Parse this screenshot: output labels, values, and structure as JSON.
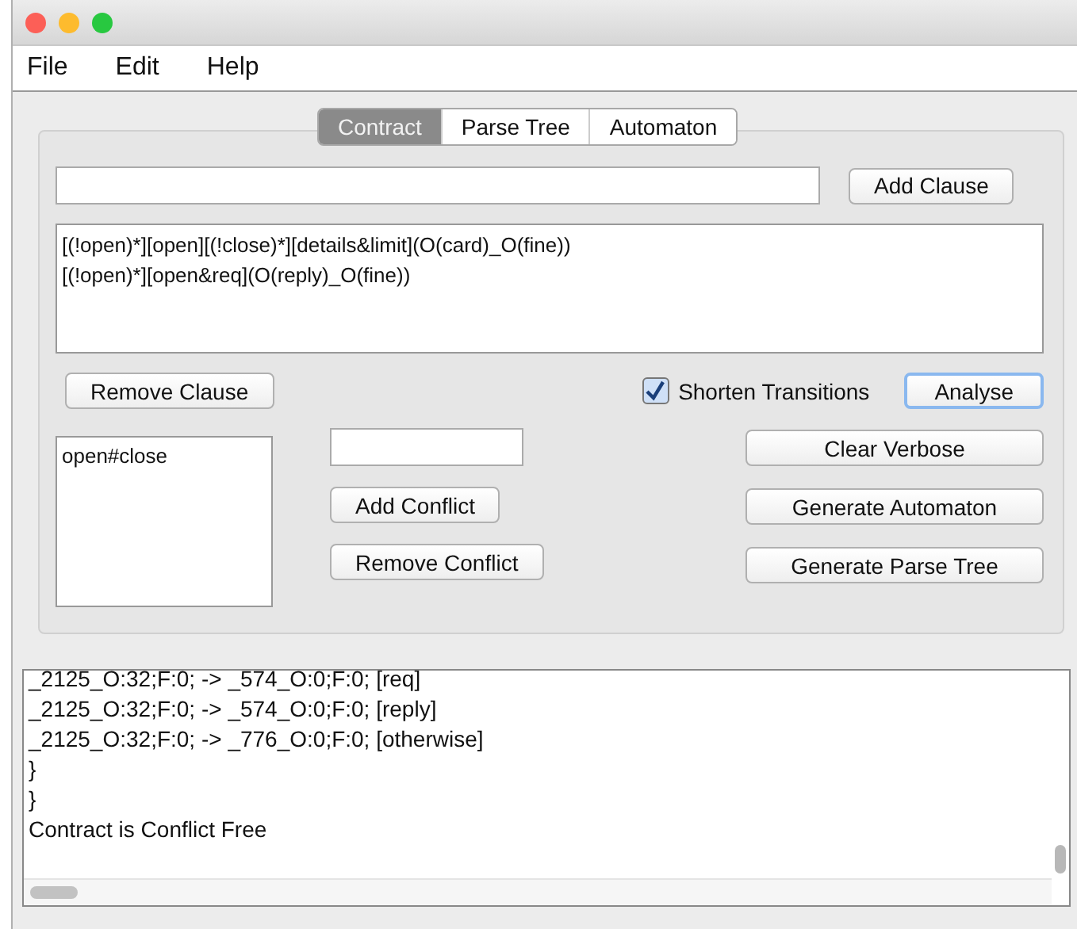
{
  "menu": [
    "File",
    "Edit",
    "Help"
  ],
  "tabs": [
    {
      "label": "Contract",
      "selected": true
    },
    {
      "label": "Parse Tree",
      "selected": false
    },
    {
      "label": "Automaton",
      "selected": false
    }
  ],
  "add_clause_button": "Add Clause",
  "clauses": [
    "[(!open)*][open][(!close)*][details&limit](O(card)_O(fine))",
    "[(!open)*][open&req](O(reply)_O(fine))"
  ],
  "remove_clause_button": "Remove Clause",
  "shorten_transitions": {
    "label": "Shorten Transitions",
    "checked": true
  },
  "analyse_button": "Analyse",
  "conflicts": [
    "open#close"
  ],
  "conflict_buttons": [
    "Add Conflict",
    "Remove Conflict"
  ],
  "action_buttons": [
    "Clear Verbose",
    "Generate Automaton",
    "Generate Parse Tree"
  ],
  "output_lines": [
    "_2125_O:32;F:0; -> _574_O:0;F:0; [req]",
    "_2125_O:32;F:0; -> _574_O:0;F:0; [reply]",
    "_2125_O:32;F:0; -> _776_O:0;F:0; [otherwise]",
    "}",
    "}",
    "Contract is Conflict Free"
  ]
}
